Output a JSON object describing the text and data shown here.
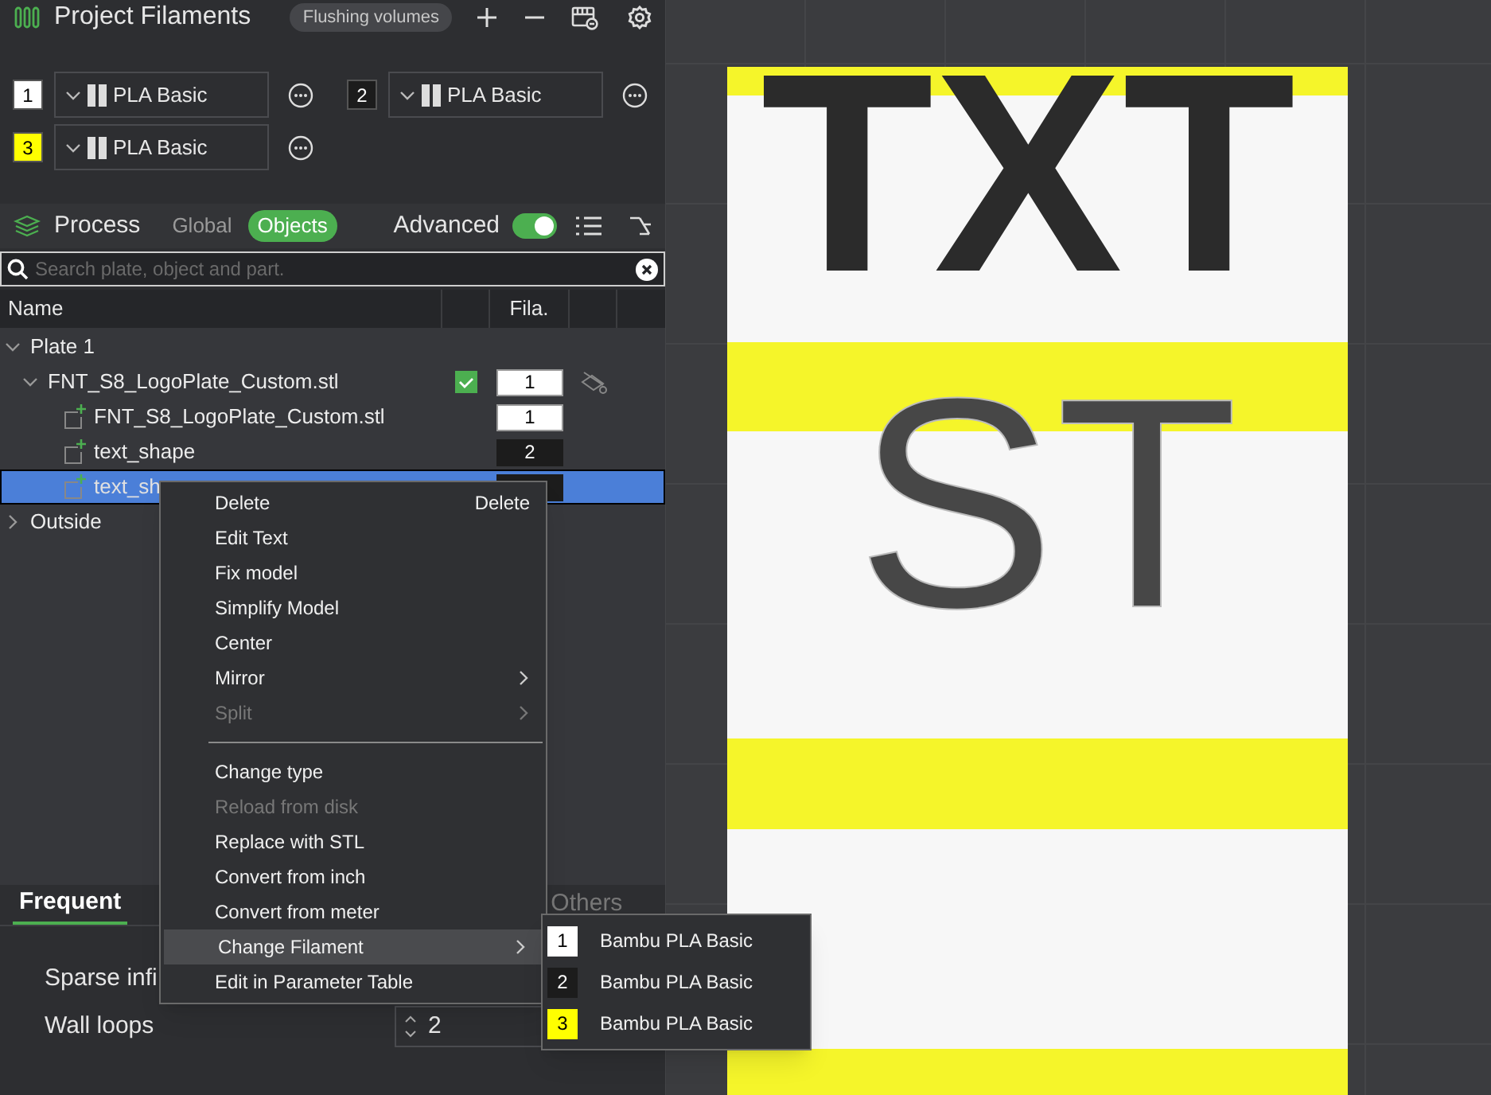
{
  "header": {
    "title": "Project Filaments",
    "flushing_button": "Flushing volumes"
  },
  "filaments": [
    {
      "index": "1",
      "color": "#ffffff",
      "name": "PLA Basic"
    },
    {
      "index": "2",
      "color": "#1c1c1c",
      "name": "PLA Basic"
    },
    {
      "index": "3",
      "color": "#ffff00",
      "name": "PLA Basic"
    }
  ],
  "process": {
    "title": "Process",
    "tabs": [
      {
        "label": "Global",
        "selected": false
      },
      {
        "label": "Objects",
        "selected": true
      }
    ],
    "advanced_label": "Advanced",
    "advanced_on": true
  },
  "search": {
    "placeholder": "Search plate, object and part."
  },
  "tree": {
    "columns": [
      "Name",
      "Fila."
    ],
    "items": [
      {
        "kind": "plate",
        "label": "Plate 1",
        "expanded": true,
        "selected": false,
        "children": [
          {
            "kind": "object",
            "label": "FNT_S8_LogoPlate_Custom.stl",
            "expanded": true,
            "selected": false,
            "checked": true,
            "filament": "1",
            "color": "#ffffff",
            "children": [
              {
                "kind": "part",
                "label": "FNT_S8_LogoPlate_Custom.stl",
                "selected": false,
                "filament": "1",
                "color": "#ffffff"
              },
              {
                "kind": "part",
                "label": "text_shape",
                "selected": false,
                "filament": "2",
                "color": "#1c1c1c"
              },
              {
                "kind": "part",
                "label": "text_sh",
                "selected": true,
                "color": "#1c1c1c"
              }
            ]
          }
        ]
      },
      {
        "kind": "plate",
        "label": "Outside",
        "expanded": false,
        "selected": false
      }
    ]
  },
  "settings_tabs": [
    {
      "label": "Frequent",
      "selected": true
    },
    {
      "label": "Others",
      "selected": false
    }
  ],
  "settings": [
    {
      "label": "Sparse infi"
    },
    {
      "label": "Wall loops",
      "value": "2"
    }
  ],
  "viewport": {
    "texts": [
      "TXT",
      "ST"
    ]
  },
  "context_menu": [
    {
      "kind": "item",
      "label": "Delete",
      "shortcut": "Delete",
      "disabled": false,
      "submenu": false,
      "selected": false
    },
    {
      "kind": "item",
      "label": "Edit Text",
      "disabled": false,
      "submenu": false,
      "selected": false
    },
    {
      "kind": "item",
      "label": "Fix model",
      "disabled": false,
      "submenu": false,
      "selected": false
    },
    {
      "kind": "item",
      "label": "Simplify Model",
      "disabled": false,
      "submenu": false,
      "selected": false
    },
    {
      "kind": "item",
      "label": "Center",
      "disabled": false,
      "submenu": false,
      "selected": false
    },
    {
      "kind": "item",
      "label": "Mirror",
      "disabled": false,
      "submenu": true,
      "selected": false
    },
    {
      "kind": "item",
      "label": "Split",
      "disabled": true,
      "submenu": true,
      "selected": false
    },
    {
      "kind": "separator"
    },
    {
      "kind": "item",
      "label": "Change type",
      "disabled": false,
      "submenu": false,
      "selected": false
    },
    {
      "kind": "item",
      "label": "Reload from disk",
      "disabled": true,
      "submenu": false,
      "selected": false
    },
    {
      "kind": "item",
      "label": "Replace with STL",
      "disabled": false,
      "submenu": false,
      "selected": false
    },
    {
      "kind": "item",
      "label": "Convert from inch",
      "disabled": false,
      "submenu": false,
      "selected": false
    },
    {
      "kind": "item",
      "label": "Convert from meter",
      "disabled": false,
      "submenu": false,
      "selected": false
    },
    {
      "kind": "item",
      "label": "Change Filament",
      "disabled": false,
      "submenu": true,
      "selected": true
    },
    {
      "kind": "item",
      "label": "Edit in Parameter Table",
      "disabled": false,
      "submenu": false,
      "selected": false
    }
  ],
  "submenu": [
    {
      "index": "1",
      "color": "#ffffff",
      "label": "Bambu PLA Basic"
    },
    {
      "index": "2",
      "color": "#1c1c1c",
      "label": "Bambu PLA Basic"
    },
    {
      "index": "3",
      "color": "#ffff00",
      "label": "Bambu PLA Basic"
    }
  ]
}
